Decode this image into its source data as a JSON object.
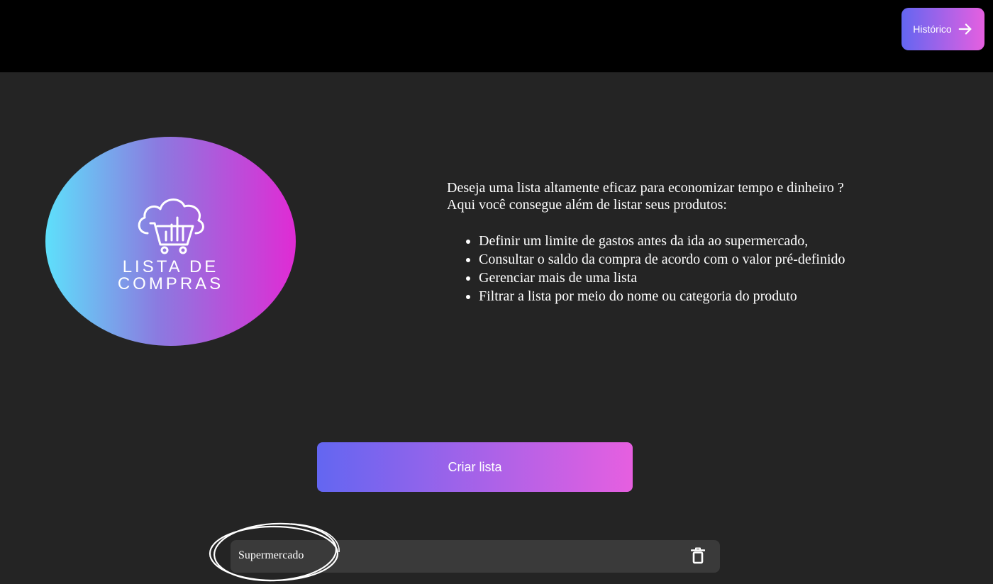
{
  "header": {
    "history_button": {
      "label": "Histórico",
      "icon": "arrow-right-icon"
    }
  },
  "logo": {
    "line1": "LISTA DE",
    "line2": "COMPRAS",
    "icon": "cloud-cart-icon",
    "gradient": [
      "#5ee0fb",
      "#e02bd4"
    ]
  },
  "intro": {
    "line1": "Deseja uma lista altamente eficaz para economizar tempo e dinheiro ?",
    "line2": "Aqui você consegue além de listar seus produtos:",
    "features": [
      "Definir um limite de gastos antes da ida ao supermercado,",
      "Consultar o saldo da compra de acordo com o valor pré-definido",
      "Gerenciar mais de uma lista",
      "Filtrar a lista por meio do nome ou categoria do produto"
    ]
  },
  "create_button": {
    "label": "Criar lista"
  },
  "lists": [
    {
      "name": "Supermercado",
      "icon": "trash-icon"
    }
  ],
  "colors": {
    "background": "#242424",
    "topbar": "#000000",
    "accent_start": "#6366f1",
    "accent_end": "#e65fe0",
    "list_row": "#3a3a3a"
  }
}
